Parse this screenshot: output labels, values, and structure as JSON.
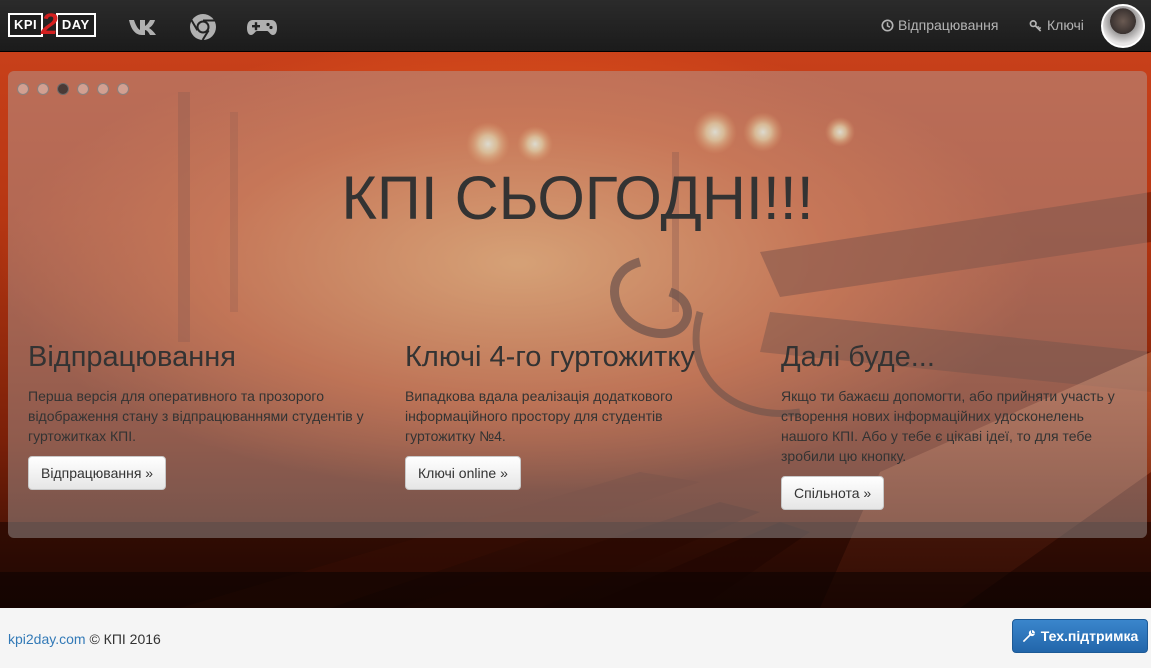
{
  "navbar": {
    "logo": {
      "left": "KPI",
      "middle": "2",
      "right": "DAY"
    },
    "icons": [
      "vk-icon",
      "chrome-icon",
      "gamepad-icon"
    ],
    "links": [
      {
        "icon": "clock-icon",
        "label": "Відпрацювання"
      },
      {
        "icon": "key-icon",
        "label": "Ключі"
      }
    ]
  },
  "hero": {
    "slides": 6,
    "active_slide": 3,
    "title": "КПІ СЬОГОДНІ!!!",
    "columns": [
      {
        "heading": "Відпрацювання",
        "text": "Перша версія для оперативного та прозорого відображення стану з відпрацюваннями студентів у гуртожитках КПІ.",
        "button": "Відпрацювання »"
      },
      {
        "heading": "Ключі 4-го гуртожитку",
        "text": "Випадкова вдала реалізація додаткового інформаційного простору для студентів гуртожитку №4.",
        "button": "Ключі online »"
      },
      {
        "heading": "Далі буде...",
        "text": "Якщо ти бажаєш допомогти, або прийняти участь у створення нових інформаційних удосконелень нашого КПІ. Або у тебе є цікаві ідеї, то для тебе зробили цю кнопку.",
        "button": "Спільнота »"
      }
    ]
  },
  "footer": {
    "site_link": "kpi2day.com",
    "copyright": "© КПІ 2016",
    "support_button": "Тех.підтримка",
    "support_icon": "wrench-icon"
  },
  "colors": {
    "navbar_bg": "#222222",
    "hero_orange": "#c8401a",
    "link_blue": "#337ab7",
    "support_blue": "#2a75bb",
    "logo_red": "#d32020"
  }
}
